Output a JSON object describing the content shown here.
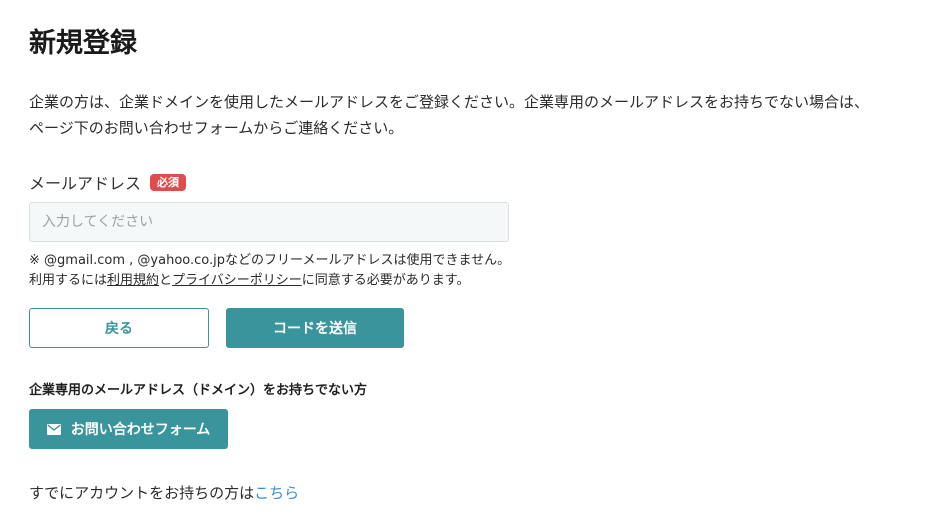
{
  "page_title": "新規登録",
  "intro": {
    "line1": "企業の方は、企業ドメインを使用したメールアドレスをご登録ください。企業専用のメールアドレスをお持ちでない場合は、",
    "line2": "ページ下のお問い合わせフォームからご連絡ください。"
  },
  "email_field": {
    "label": "メールアドレス",
    "required_badge": "必須",
    "placeholder": "入力してください",
    "value": ""
  },
  "notes": {
    "line1": "※ @gmail.com , @yahoo.co.jpなどのフリーメールアドレスは使用できません。",
    "line2_prefix": "利用するには",
    "terms_link": "利用規約",
    "line2_and": "と",
    "privacy_link": "プライバシーポリシー",
    "line2_suffix": "に同意する必要があります。"
  },
  "buttons": {
    "back_label": "戻る",
    "send_code_label": "コードを送信"
  },
  "no_domain_section": {
    "heading": "企業専用のメールアドレス（ドメイン）をお持ちでない方",
    "contact_button_label": "お問い合わせフォーム",
    "contact_icon": "mail-icon"
  },
  "login_prompt": {
    "text": "すでにアカウントをお持ちの方は",
    "link": "こちら"
  },
  "colors": {
    "accent": "#3a949b",
    "required": "#e04b4b",
    "link": "#3a8fd0"
  }
}
